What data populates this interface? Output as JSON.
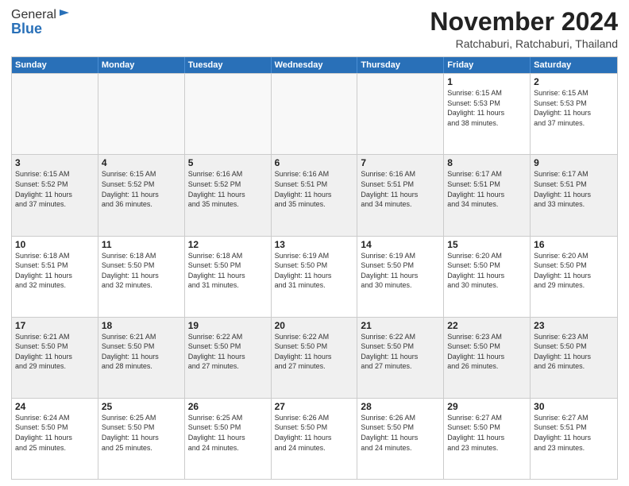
{
  "logo": {
    "line1": "General",
    "line2": "Blue"
  },
  "header": {
    "month": "November 2024",
    "location": "Ratchaburi, Ratchaburi, Thailand"
  },
  "weekdays": [
    "Sunday",
    "Monday",
    "Tuesday",
    "Wednesday",
    "Thursday",
    "Friday",
    "Saturday"
  ],
  "weeks": [
    [
      {
        "day": "",
        "info": "",
        "empty": true
      },
      {
        "day": "",
        "info": "",
        "empty": true
      },
      {
        "day": "",
        "info": "",
        "empty": true
      },
      {
        "day": "",
        "info": "",
        "empty": true
      },
      {
        "day": "",
        "info": "",
        "empty": true
      },
      {
        "day": "1",
        "info": "Sunrise: 6:15 AM\nSunset: 5:53 PM\nDaylight: 11 hours\nand 38 minutes.",
        "empty": false
      },
      {
        "day": "2",
        "info": "Sunrise: 6:15 AM\nSunset: 5:53 PM\nDaylight: 11 hours\nand 37 minutes.",
        "empty": false
      }
    ],
    [
      {
        "day": "3",
        "info": "Sunrise: 6:15 AM\nSunset: 5:52 PM\nDaylight: 11 hours\nand 37 minutes.",
        "empty": false
      },
      {
        "day": "4",
        "info": "Sunrise: 6:15 AM\nSunset: 5:52 PM\nDaylight: 11 hours\nand 36 minutes.",
        "empty": false
      },
      {
        "day": "5",
        "info": "Sunrise: 6:16 AM\nSunset: 5:52 PM\nDaylight: 11 hours\nand 35 minutes.",
        "empty": false
      },
      {
        "day": "6",
        "info": "Sunrise: 6:16 AM\nSunset: 5:51 PM\nDaylight: 11 hours\nand 35 minutes.",
        "empty": false
      },
      {
        "day": "7",
        "info": "Sunrise: 6:16 AM\nSunset: 5:51 PM\nDaylight: 11 hours\nand 34 minutes.",
        "empty": false
      },
      {
        "day": "8",
        "info": "Sunrise: 6:17 AM\nSunset: 5:51 PM\nDaylight: 11 hours\nand 34 minutes.",
        "empty": false
      },
      {
        "day": "9",
        "info": "Sunrise: 6:17 AM\nSunset: 5:51 PM\nDaylight: 11 hours\nand 33 minutes.",
        "empty": false
      }
    ],
    [
      {
        "day": "10",
        "info": "Sunrise: 6:18 AM\nSunset: 5:51 PM\nDaylight: 11 hours\nand 32 minutes.",
        "empty": false
      },
      {
        "day": "11",
        "info": "Sunrise: 6:18 AM\nSunset: 5:50 PM\nDaylight: 11 hours\nand 32 minutes.",
        "empty": false
      },
      {
        "day": "12",
        "info": "Sunrise: 6:18 AM\nSunset: 5:50 PM\nDaylight: 11 hours\nand 31 minutes.",
        "empty": false
      },
      {
        "day": "13",
        "info": "Sunrise: 6:19 AM\nSunset: 5:50 PM\nDaylight: 11 hours\nand 31 minutes.",
        "empty": false
      },
      {
        "day": "14",
        "info": "Sunrise: 6:19 AM\nSunset: 5:50 PM\nDaylight: 11 hours\nand 30 minutes.",
        "empty": false
      },
      {
        "day": "15",
        "info": "Sunrise: 6:20 AM\nSunset: 5:50 PM\nDaylight: 11 hours\nand 30 minutes.",
        "empty": false
      },
      {
        "day": "16",
        "info": "Sunrise: 6:20 AM\nSunset: 5:50 PM\nDaylight: 11 hours\nand 29 minutes.",
        "empty": false
      }
    ],
    [
      {
        "day": "17",
        "info": "Sunrise: 6:21 AM\nSunset: 5:50 PM\nDaylight: 11 hours\nand 29 minutes.",
        "empty": false
      },
      {
        "day": "18",
        "info": "Sunrise: 6:21 AM\nSunset: 5:50 PM\nDaylight: 11 hours\nand 28 minutes.",
        "empty": false
      },
      {
        "day": "19",
        "info": "Sunrise: 6:22 AM\nSunset: 5:50 PM\nDaylight: 11 hours\nand 27 minutes.",
        "empty": false
      },
      {
        "day": "20",
        "info": "Sunrise: 6:22 AM\nSunset: 5:50 PM\nDaylight: 11 hours\nand 27 minutes.",
        "empty": false
      },
      {
        "day": "21",
        "info": "Sunrise: 6:22 AM\nSunset: 5:50 PM\nDaylight: 11 hours\nand 27 minutes.",
        "empty": false
      },
      {
        "day": "22",
        "info": "Sunrise: 6:23 AM\nSunset: 5:50 PM\nDaylight: 11 hours\nand 26 minutes.",
        "empty": false
      },
      {
        "day": "23",
        "info": "Sunrise: 6:23 AM\nSunset: 5:50 PM\nDaylight: 11 hours\nand 26 minutes.",
        "empty": false
      }
    ],
    [
      {
        "day": "24",
        "info": "Sunrise: 6:24 AM\nSunset: 5:50 PM\nDaylight: 11 hours\nand 25 minutes.",
        "empty": false
      },
      {
        "day": "25",
        "info": "Sunrise: 6:25 AM\nSunset: 5:50 PM\nDaylight: 11 hours\nand 25 minutes.",
        "empty": false
      },
      {
        "day": "26",
        "info": "Sunrise: 6:25 AM\nSunset: 5:50 PM\nDaylight: 11 hours\nand 24 minutes.",
        "empty": false
      },
      {
        "day": "27",
        "info": "Sunrise: 6:26 AM\nSunset: 5:50 PM\nDaylight: 11 hours\nand 24 minutes.",
        "empty": false
      },
      {
        "day": "28",
        "info": "Sunrise: 6:26 AM\nSunset: 5:50 PM\nDaylight: 11 hours\nand 24 minutes.",
        "empty": false
      },
      {
        "day": "29",
        "info": "Sunrise: 6:27 AM\nSunset: 5:50 PM\nDaylight: 11 hours\nand 23 minutes.",
        "empty": false
      },
      {
        "day": "30",
        "info": "Sunrise: 6:27 AM\nSunset: 5:51 PM\nDaylight: 11 hours\nand 23 minutes.",
        "empty": false
      }
    ]
  ]
}
